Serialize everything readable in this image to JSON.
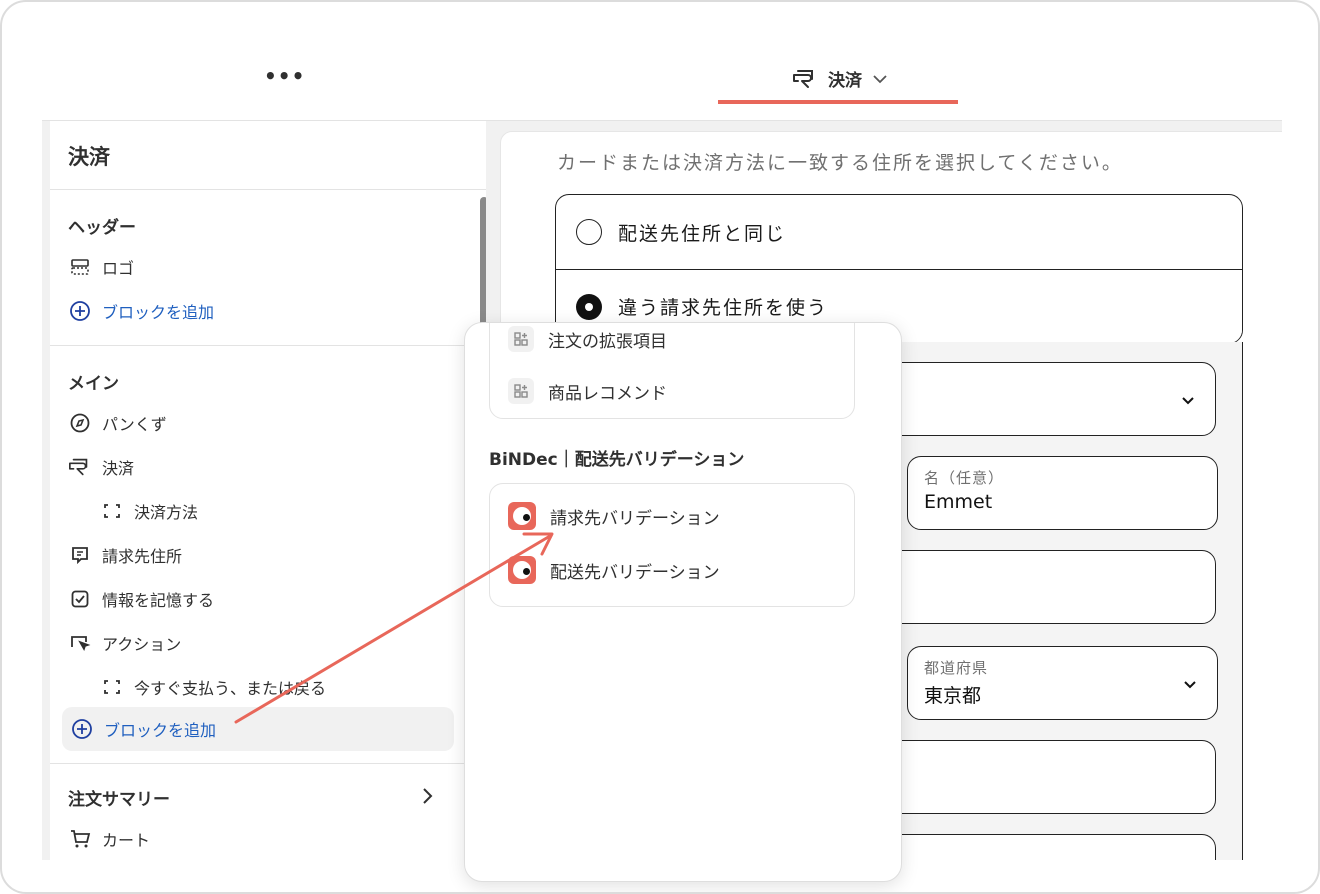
{
  "topbar": {
    "more_label": "•••",
    "page_label": "決済",
    "accent_color": "#e8675a"
  },
  "sidebar": {
    "title": "決済",
    "sections": {
      "header": {
        "heading": "ヘッダー",
        "items": [
          {
            "label": "ロゴ",
            "icon": "logo-block-icon"
          },
          {
            "label": "ブロックを追加",
            "icon": "plus-circle-icon"
          }
        ]
      },
      "main": {
        "heading": "メイン",
        "items": [
          {
            "label": "パンくず",
            "icon": "compass-icon"
          },
          {
            "label": "決済",
            "icon": "payment-hand-icon"
          },
          {
            "label": "決済方法",
            "icon": "section-bracket-icon"
          },
          {
            "label": "請求先住所",
            "icon": "address-icon"
          },
          {
            "label": "情報を記憶する",
            "icon": "checkbox-icon"
          },
          {
            "label": "アクション",
            "icon": "cursor-icon"
          },
          {
            "label": "今すぐ支払う、または戻る",
            "icon": "section-bracket-icon"
          },
          {
            "label": "ブロックを追加",
            "icon": "plus-circle-icon"
          }
        ]
      },
      "summary": {
        "heading": "注文サマリー",
        "items": [
          {
            "label": "カート",
            "icon": "cart-icon"
          }
        ]
      }
    }
  },
  "preview": {
    "subtitle": "カードまたは決済方法に一致する住所を選択してください。",
    "radio_same": "配送先住所と同じ",
    "radio_different": "違う請求先住所を使う",
    "first_name_label": "名（任意）",
    "first_name_value": "Emmet",
    "prefecture_label": "都道府県",
    "prefecture_value": "東京都"
  },
  "popup": {
    "items_top": [
      {
        "label": "注文の拡張項目",
        "icon": "app-block-icon"
      },
      {
        "label": "商品レコメンド",
        "icon": "app-block-icon"
      }
    ],
    "section_title": "BiNDec｜配送先バリデーション",
    "app_items": [
      {
        "label": "請求先バリデーション",
        "icon": "bindec-app-icon"
      },
      {
        "label": "配送先バリデーション",
        "icon": "bindec-app-icon"
      }
    ]
  }
}
